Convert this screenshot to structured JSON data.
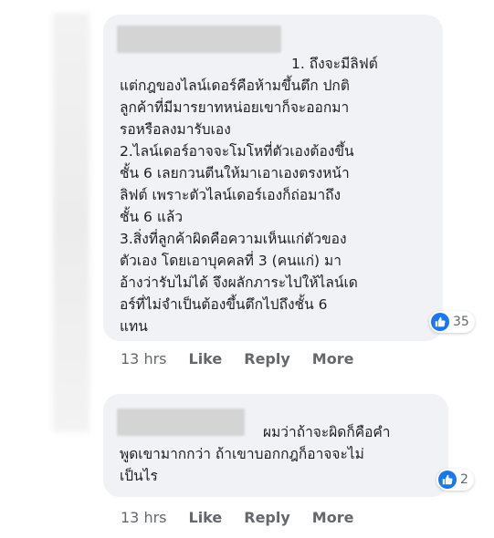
{
  "comments": [
    {
      "author_blurred": true,
      "first_line": "1. ถึงจะมีลิฟต์",
      "lines": [
        "แต่กฎของไลน์เดอร์คือห้ามขึ้นตึก ปกติ",
        "ลูกค้าที่มีมารยาทหน่อยเขาก็จะออกมา",
        "รอหรือลงมารับเอง",
        "2.ไลน์เดอร์อาจจะโมโหที่ตัวเองต้องขึ้น",
        "ชั้น 6 เลยกวนตีนให้มาเอาเองตรงหน้า",
        "ลิฟต์ เพราะตัวไลน์เดอร์เองก็ถ่อมาถึง",
        "ชั้น 6 แล้ว",
        "3.สิ่งที่ลูกค้าผิดคือความเห็นแก่ตัวของ",
        "ตัวเอง โดยเอาบุคคลที่ 3 (คนแก่) มา",
        "อ้างว่ารับไม่ได้ จึงผลักภาระไปให้ไลน์เด",
        "อร์ที่ไม่จำเป็นต้องขึ้นตึกไปถึงชั้น 6",
        "แทน"
      ],
      "reaction_icon": "like-icon",
      "reaction_count": "35",
      "time": "13 hrs",
      "like_label": "Like",
      "reply_label": "Reply",
      "more_label": "More"
    },
    {
      "author_blurred": true,
      "first_line": "ผมว่าถ้าจะผิดก็คือคำ",
      "lines": [
        "พูดเขามากกว่า ถ้าเขาบอกกฎก็อาจจะไม่",
        "เป็นไร"
      ],
      "reaction_icon": "like-icon",
      "reaction_count": "2",
      "time": "13 hrs",
      "like_label": "Like",
      "reply_label": "Reply",
      "more_label": "More"
    }
  ],
  "colors": {
    "bubble": "#f0f2f5",
    "text": "#1c1e21",
    "meta": "#65676b",
    "like_blue": "#1877f2"
  }
}
